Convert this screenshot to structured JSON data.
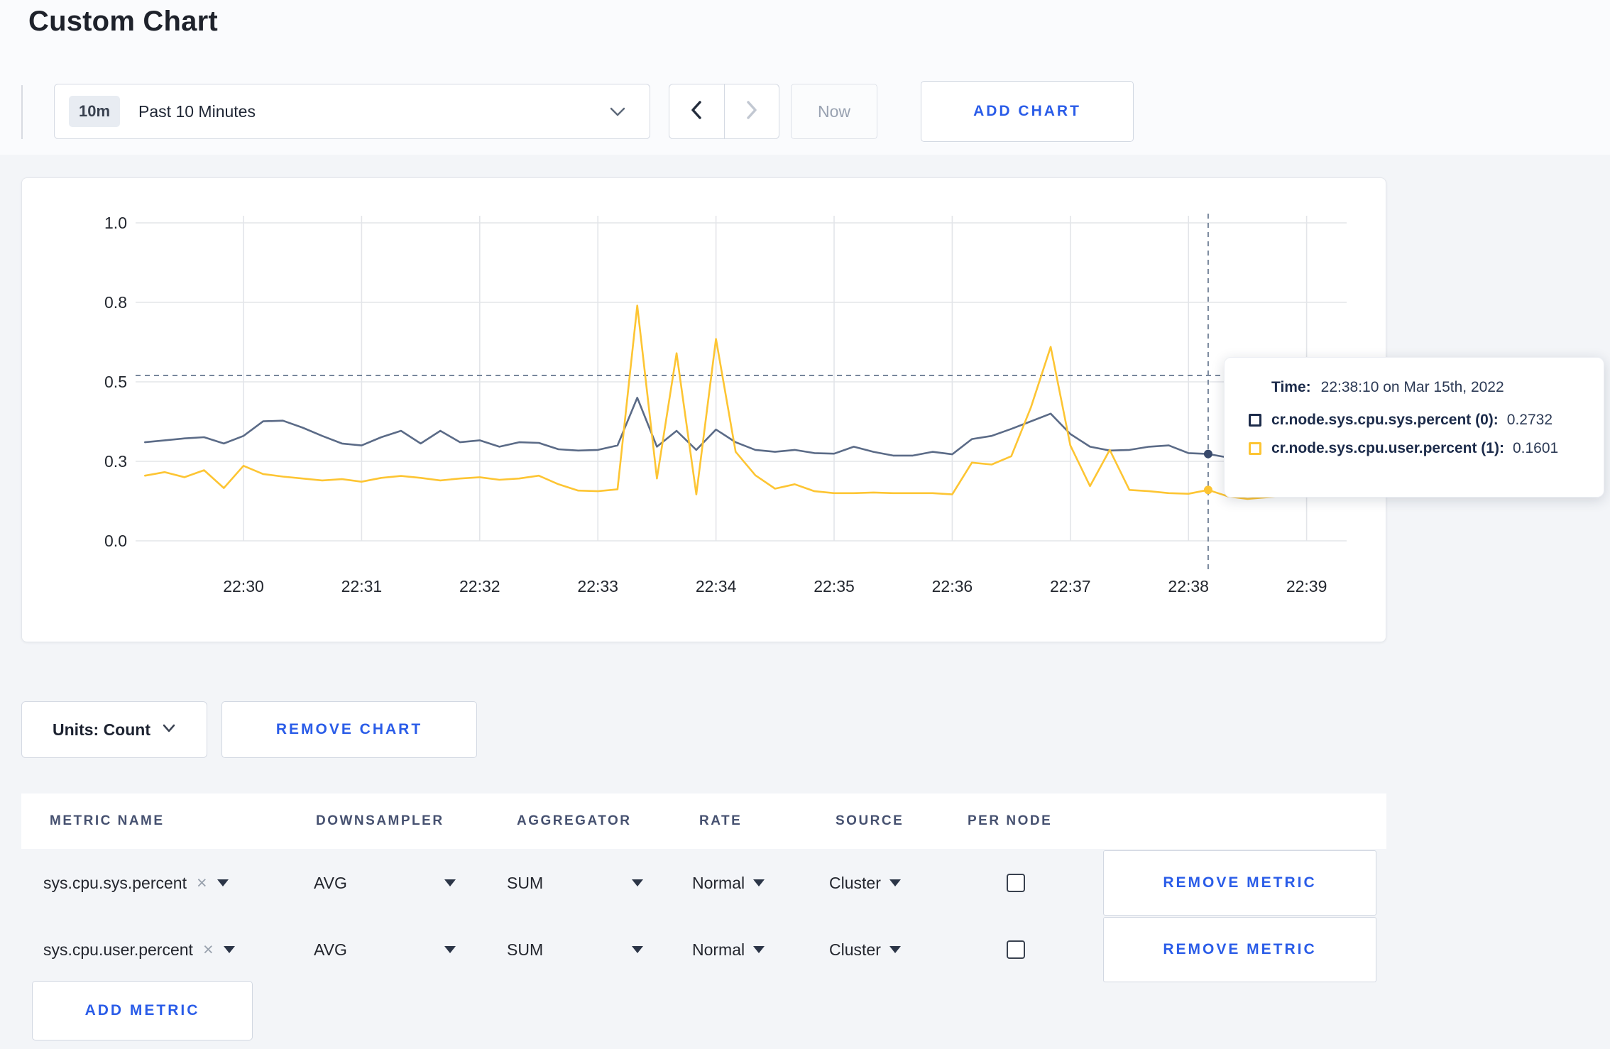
{
  "page": {
    "title": "Custom Chart",
    "background": "#f3f5f8",
    "accent_blue": "#2a5ce8"
  },
  "toolbar": {
    "time_window": {
      "badge": "10m",
      "label": "Past 10 Minutes"
    },
    "now_label": "Now",
    "add_chart_label": "ADD CHART"
  },
  "tooltip": {
    "time_label": "Time:",
    "time_value": "22:38:10 on Mar 15th, 2022",
    "series": [
      {
        "name": "cr.node.sys.cpu.sys.percent (0):",
        "value": "0.2732",
        "swatch_color": "#1c2b4a"
      },
      {
        "name": "cr.node.sys.cpu.user.percent (1):",
        "value": "0.1601",
        "swatch_color": "#fdc533"
      }
    ]
  },
  "chart_controls": {
    "units_label": "Units: Count",
    "remove_chart_label": "REMOVE CHART"
  },
  "metrics_table": {
    "headers": [
      "METRIC NAME",
      "DOWNSAMPLER",
      "AGGREGATOR",
      "RATE",
      "SOURCE",
      "PER NODE"
    ],
    "clear_icon": "×",
    "rows": [
      {
        "metric": "sys.cpu.sys.percent",
        "downsampler": "AVG",
        "aggregator": "SUM",
        "rate": "Normal",
        "source": "Cluster",
        "per_node": false,
        "remove_label": "REMOVE METRIC"
      },
      {
        "metric": "sys.cpu.user.percent",
        "downsampler": "AVG",
        "aggregator": "SUM",
        "rate": "Normal",
        "source": "Cluster",
        "per_node": false,
        "remove_label": "REMOVE METRIC"
      }
    ],
    "add_metric_label": "ADD METRIC"
  },
  "chart_data": {
    "type": "line",
    "title": "",
    "xlabel": "",
    "ylabel": "",
    "ylim": [
      0,
      1
    ],
    "grid": true,
    "legend_position": "tooltip-only",
    "y_ticks": [
      {
        "label": "0.0",
        "value": 0.0
      },
      {
        "label": "0.3",
        "value": 0.25
      },
      {
        "label": "0.5",
        "value": 0.5
      },
      {
        "label": "0.8",
        "value": 0.75
      },
      {
        "label": "1.0",
        "value": 1.0
      }
    ],
    "x_tick_labels": [
      "22:30",
      "22:31",
      "22:32",
      "22:33",
      "22:34",
      "22:35",
      "22:36",
      "22:37",
      "22:38",
      "22:39"
    ],
    "start_time": "22:29:10",
    "interval_sec": 10,
    "series": [
      {
        "name": "cr.node.sys.cpu.sys.percent",
        "color": "#5b6b87",
        "values": [
          0.31,
          0.316,
          0.322,
          0.326,
          0.306,
          0.33,
          0.376,
          0.378,
          0.356,
          0.33,
          0.306,
          0.3,
          0.326,
          0.346,
          0.306,
          0.346,
          0.31,
          0.316,
          0.296,
          0.31,
          0.308,
          0.288,
          0.284,
          0.286,
          0.3,
          0.45,
          0.296,
          0.346,
          0.286,
          0.35,
          0.31,
          0.286,
          0.28,
          0.286,
          0.276,
          0.274,
          0.296,
          0.28,
          0.268,
          0.268,
          0.28,
          0.272,
          0.32,
          0.33,
          0.352,
          0.376,
          0.4,
          0.336,
          0.296,
          0.284,
          0.286,
          0.296,
          0.3,
          0.276,
          0.2732,
          0.262,
          0.256,
          0.258,
          0.268,
          0.278,
          0.292,
          0.286
        ]
      },
      {
        "name": "cr.node.sys.cpu.user.percent",
        "color": "#fdc533",
        "values": [
          0.205,
          0.216,
          0.2,
          0.222,
          0.166,
          0.236,
          0.21,
          0.202,
          0.196,
          0.19,
          0.194,
          0.186,
          0.198,
          0.204,
          0.198,
          0.19,
          0.196,
          0.2,
          0.192,
          0.196,
          0.205,
          0.178,
          0.158,
          0.156,
          0.162,
          0.74,
          0.196,
          0.59,
          0.146,
          0.635,
          0.28,
          0.206,
          0.164,
          0.178,
          0.156,
          0.15,
          0.15,
          0.152,
          0.15,
          0.15,
          0.15,
          0.146,
          0.246,
          0.24,
          0.266,
          0.42,
          0.61,
          0.3,
          0.172,
          0.286,
          0.16,
          0.156,
          0.15,
          0.148,
          0.1601,
          0.14,
          0.132,
          0.137,
          0.142,
          0.18,
          0.255,
          0.222
        ]
      }
    ],
    "crosshair": {
      "time": "22:38:10",
      "index": 54,
      "hline_value": 0.52
    },
    "markers": [
      {
        "series": 0,
        "index": 54,
        "value": 0.2732
      },
      {
        "series": 1,
        "index": 54,
        "value": 0.1601
      }
    ]
  }
}
